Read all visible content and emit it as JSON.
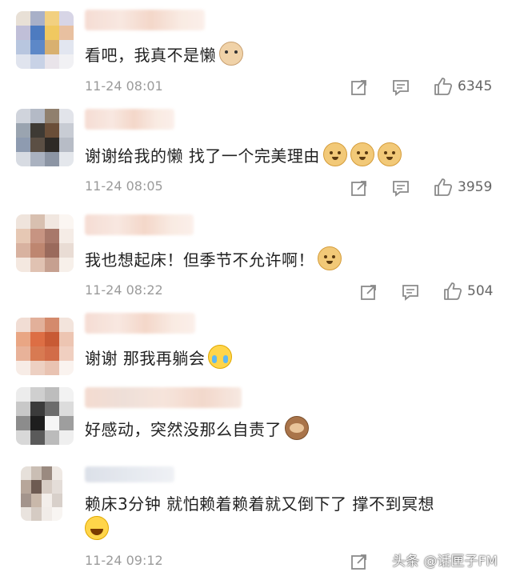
{
  "comments": [
    {
      "text": "看吧，我真不是懒",
      "emojis": [
        "cat-face"
      ],
      "time": "11-24 08:01",
      "likes": "6345",
      "avatar_colors": [
        "#e8e0d6",
        "#a8b0c8",
        "#f2d080",
        "#d7d5e6",
        "#c0bfd8",
        "#4d7bc0",
        "#f0c860",
        "#e8c0a0",
        "#b8c6df",
        "#5d88c8",
        "#d8b070",
        "#e2e6f0",
        "#e0e4ee",
        "#c8d2e6",
        "#e9e4ea",
        "#f1f1f4"
      ]
    },
    {
      "text": "谢谢给我的懒 找了一个完美理由",
      "emojis": [
        "dog-face",
        "dog-face",
        "dog-face"
      ],
      "time": "11-24 08:05",
      "likes": "3959",
      "avatar_colors": [
        "#d0d4dc",
        "#b4bac6",
        "#90806e",
        "#e2e4ea",
        "#9aa4b0",
        "#3e3a34",
        "#6a4e38",
        "#c8ccd4",
        "#8e9bb0",
        "#5b4f44",
        "#2e2a26",
        "#b7bcc6",
        "#d7dbe2",
        "#aab2c0",
        "#8c95a4",
        "#e4e7ec"
      ]
    },
    {
      "text": "我也想起床！但季节不允许啊！",
      "emojis": [
        "dog-face"
      ],
      "time": "11-24 08:22",
      "likes": "504",
      "avatar_colors": [
        "#efe4dc",
        "#d8c0b0",
        "#f1e7e0",
        "#fbf6f2",
        "#e6c8b4",
        "#c79482",
        "#a8786a",
        "#f5ece6",
        "#d8b2a0",
        "#be8670",
        "#9a6a5c",
        "#e9dcd4",
        "#f4e8e0",
        "#e0c2b2",
        "#c6a090",
        "#f7f0ea"
      ]
    },
    {
      "text": "谢谢 那我再躺会",
      "emojis": [
        "crying-face"
      ],
      "time": "",
      "likes": "",
      "avatar_colors": [
        "#f1ddd4",
        "#e2b09a",
        "#d48a6c",
        "#f3e4dc",
        "#e9a684",
        "#dd6e44",
        "#c85a34",
        "#edc5b2",
        "#e8b299",
        "#d87a52",
        "#d26c48",
        "#f0cfc0",
        "#f7ece6",
        "#edd0c2",
        "#e9c3b2",
        "#faf3ef"
      ]
    },
    {
      "text": "好感动，突然没那么自责了",
      "emojis": [
        "see-no-evil-monkey"
      ],
      "time": "",
      "likes": "",
      "avatar_colors": [
        "#ececec",
        "#cfcfcf",
        "#bdbdbd",
        "#f2f2f2",
        "#c8c8c8",
        "#3b3b3b",
        "#6c6c6c",
        "#dcdcdc",
        "#8c8c8c",
        "#1e1e1e",
        "#f6f6f6",
        "#9e9e9e",
        "#d8d8d8",
        "#5a5a5a",
        "#bbbbbb",
        "#efefef"
      ]
    },
    {
      "text": "赖床3分钟 就怕赖着赖着就又倒下了 撑不到冥想",
      "emojis": [
        "laughing-tears-face"
      ],
      "time": "11-24 09:12",
      "likes": "",
      "avatar_colors": [
        "#e6e0da",
        "#cabeb4",
        "#9a8a80",
        "#efe9e4",
        "#b7a69a",
        "#6e5b52",
        "#d7ccc4",
        "#e4ddd8",
        "#a3948c",
        "#c9b8aa",
        "#f3eeea",
        "#d8d0ca",
        "#e9e3de",
        "#d5cbc3",
        "#f1ece8",
        "#f8f5f2"
      ]
    }
  ],
  "watermark": "头条 @话匣子FM",
  "icons": {
    "share": "share-icon",
    "comment": "comment-icon",
    "like": "thumbs-up-icon"
  },
  "colors": {
    "meta_gray": "#9b9b9b",
    "text": "#222222"
  }
}
